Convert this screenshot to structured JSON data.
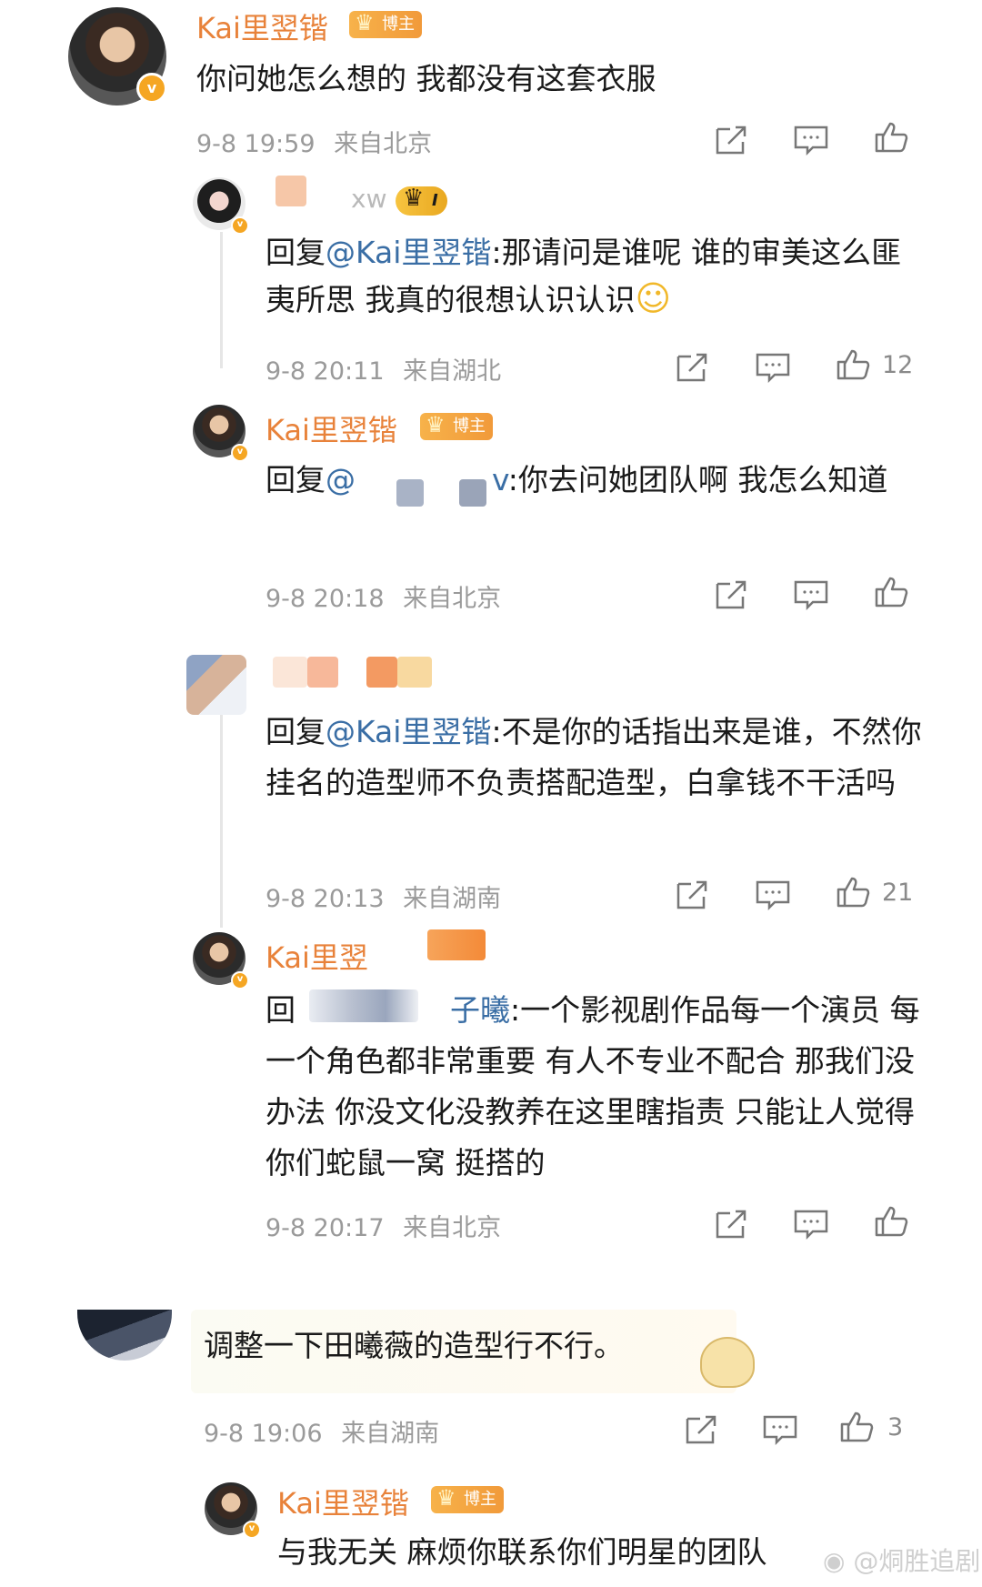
{
  "comments": [
    {
      "name": "Kai里翌锴",
      "badge": "博主",
      "text": "你问她怎么想的 我都没有这套衣服",
      "time": "9-8 19:59",
      "location": "来自北京"
    },
    {
      "name_fragment": "xw",
      "badge": "I",
      "prefix": "回复",
      "mention": "@Kai里翌锴",
      "text": ":那请问是谁呢 谁的审美这么匪夷所思 我真的很想认识认识",
      "emoji": "☺",
      "time": "9-8 20:11",
      "location": "来自湖北",
      "likes": "12"
    },
    {
      "name": "Kai里翌锴",
      "badge": "博主",
      "prefix": "回复",
      "mention_start": "@",
      "mention_end": "v",
      "text": ":你去问她团队啊 我怎么知道",
      "time": "9-8 20:18",
      "location": "来自北京"
    },
    {
      "prefix": "回复",
      "mention": "@Kai里翌锴",
      "text": ":不是你的话指出来是谁，不然你挂名的造型师不负责搭配造型，白拿钱不干活吗",
      "time": "9-8 20:13",
      "location": "来自湖南",
      "likes": "21"
    },
    {
      "name_fragment": "Kai里翌",
      "prefix": "回",
      "mention_end": "子曦",
      "text": ":一个影视剧作品每一个演员 每一个角色都非常重要 有人不专业不配合 那我们没办法 你没文化没教养在这里瞎指责 只能让人觉得 你们蛇鼠一窝 挺搭的",
      "time": "9-8 20:17",
      "location": "来自北京"
    },
    {
      "text": "调整一下田曦薇的造型行不行。",
      "time": "9-8 19:06",
      "location": "来自湖南",
      "likes": "3"
    },
    {
      "name": "Kai里翌锴",
      "badge": "博主",
      "text": "与我无关 麻烦你联系你们明星的团队"
    }
  ],
  "watermark": "@烔胜追剧",
  "icons": {
    "share": "share-icon",
    "comment": "comment-icon",
    "like": "like-icon",
    "verified": "verified-icon"
  },
  "colors": {
    "name": "#e8823a",
    "mention": "#3a6ea5",
    "meta": "#9a9a9a",
    "badge": "#f5a623"
  }
}
